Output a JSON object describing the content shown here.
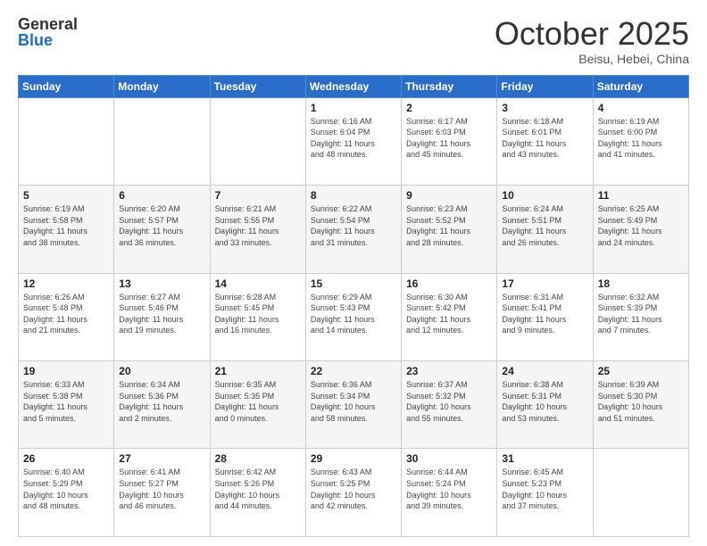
{
  "header": {
    "logo_general": "General",
    "logo_blue": "Blue",
    "month_title": "October 2025",
    "location": "Beisu, Hebei, China"
  },
  "days_of_week": [
    "Sunday",
    "Monday",
    "Tuesday",
    "Wednesday",
    "Thursday",
    "Friday",
    "Saturday"
  ],
  "weeks": [
    [
      {
        "day": "",
        "info": ""
      },
      {
        "day": "",
        "info": ""
      },
      {
        "day": "",
        "info": ""
      },
      {
        "day": "1",
        "info": "Sunrise: 6:16 AM\nSunset: 6:04 PM\nDaylight: 11 hours\nand 48 minutes."
      },
      {
        "day": "2",
        "info": "Sunrise: 6:17 AM\nSunset: 6:03 PM\nDaylight: 11 hours\nand 45 minutes."
      },
      {
        "day": "3",
        "info": "Sunrise: 6:18 AM\nSunset: 6:01 PM\nDaylight: 11 hours\nand 43 minutes."
      },
      {
        "day": "4",
        "info": "Sunrise: 6:19 AM\nSunset: 6:00 PM\nDaylight: 11 hours\nand 41 minutes."
      }
    ],
    [
      {
        "day": "5",
        "info": "Sunrise: 6:19 AM\nSunset: 5:58 PM\nDaylight: 11 hours\nand 38 minutes."
      },
      {
        "day": "6",
        "info": "Sunrise: 6:20 AM\nSunset: 5:57 PM\nDaylight: 11 hours\nand 36 minutes."
      },
      {
        "day": "7",
        "info": "Sunrise: 6:21 AM\nSunset: 5:55 PM\nDaylight: 11 hours\nand 33 minutes."
      },
      {
        "day": "8",
        "info": "Sunrise: 6:22 AM\nSunset: 5:54 PM\nDaylight: 11 hours\nand 31 minutes."
      },
      {
        "day": "9",
        "info": "Sunrise: 6:23 AM\nSunset: 5:52 PM\nDaylight: 11 hours\nand 28 minutes."
      },
      {
        "day": "10",
        "info": "Sunrise: 6:24 AM\nSunset: 5:51 PM\nDaylight: 11 hours\nand 26 minutes."
      },
      {
        "day": "11",
        "info": "Sunrise: 6:25 AM\nSunset: 5:49 PM\nDaylight: 11 hours\nand 24 minutes."
      }
    ],
    [
      {
        "day": "12",
        "info": "Sunrise: 6:26 AM\nSunset: 5:48 PM\nDaylight: 11 hours\nand 21 minutes."
      },
      {
        "day": "13",
        "info": "Sunrise: 6:27 AM\nSunset: 5:46 PM\nDaylight: 11 hours\nand 19 minutes."
      },
      {
        "day": "14",
        "info": "Sunrise: 6:28 AM\nSunset: 5:45 PM\nDaylight: 11 hours\nand 16 minutes."
      },
      {
        "day": "15",
        "info": "Sunrise: 6:29 AM\nSunset: 5:43 PM\nDaylight: 11 hours\nand 14 minutes."
      },
      {
        "day": "16",
        "info": "Sunrise: 6:30 AM\nSunset: 5:42 PM\nDaylight: 11 hours\nand 12 minutes."
      },
      {
        "day": "17",
        "info": "Sunrise: 6:31 AM\nSunset: 5:41 PM\nDaylight: 11 hours\nand 9 minutes."
      },
      {
        "day": "18",
        "info": "Sunrise: 6:32 AM\nSunset: 5:39 PM\nDaylight: 11 hours\nand 7 minutes."
      }
    ],
    [
      {
        "day": "19",
        "info": "Sunrise: 6:33 AM\nSunset: 5:38 PM\nDaylight: 11 hours\nand 5 minutes."
      },
      {
        "day": "20",
        "info": "Sunrise: 6:34 AM\nSunset: 5:36 PM\nDaylight: 11 hours\nand 2 minutes."
      },
      {
        "day": "21",
        "info": "Sunrise: 6:35 AM\nSunset: 5:35 PM\nDaylight: 11 hours\nand 0 minutes."
      },
      {
        "day": "22",
        "info": "Sunrise: 6:36 AM\nSunset: 5:34 PM\nDaylight: 10 hours\nand 58 minutes."
      },
      {
        "day": "23",
        "info": "Sunrise: 6:37 AM\nSunset: 5:32 PM\nDaylight: 10 hours\nand 55 minutes."
      },
      {
        "day": "24",
        "info": "Sunrise: 6:38 AM\nSunset: 5:31 PM\nDaylight: 10 hours\nand 53 minutes."
      },
      {
        "day": "25",
        "info": "Sunrise: 6:39 AM\nSunset: 5:30 PM\nDaylight: 10 hours\nand 51 minutes."
      }
    ],
    [
      {
        "day": "26",
        "info": "Sunrise: 6:40 AM\nSunset: 5:29 PM\nDaylight: 10 hours\nand 48 minutes."
      },
      {
        "day": "27",
        "info": "Sunrise: 6:41 AM\nSunset: 5:27 PM\nDaylight: 10 hours\nand 46 minutes."
      },
      {
        "day": "28",
        "info": "Sunrise: 6:42 AM\nSunset: 5:26 PM\nDaylight: 10 hours\nand 44 minutes."
      },
      {
        "day": "29",
        "info": "Sunrise: 6:43 AM\nSunset: 5:25 PM\nDaylight: 10 hours\nand 42 minutes."
      },
      {
        "day": "30",
        "info": "Sunrise: 6:44 AM\nSunset: 5:24 PM\nDaylight: 10 hours\nand 39 minutes."
      },
      {
        "day": "31",
        "info": "Sunrise: 6:45 AM\nSunset: 5:23 PM\nDaylight: 10 hours\nand 37 minutes."
      },
      {
        "day": "",
        "info": ""
      }
    ]
  ]
}
